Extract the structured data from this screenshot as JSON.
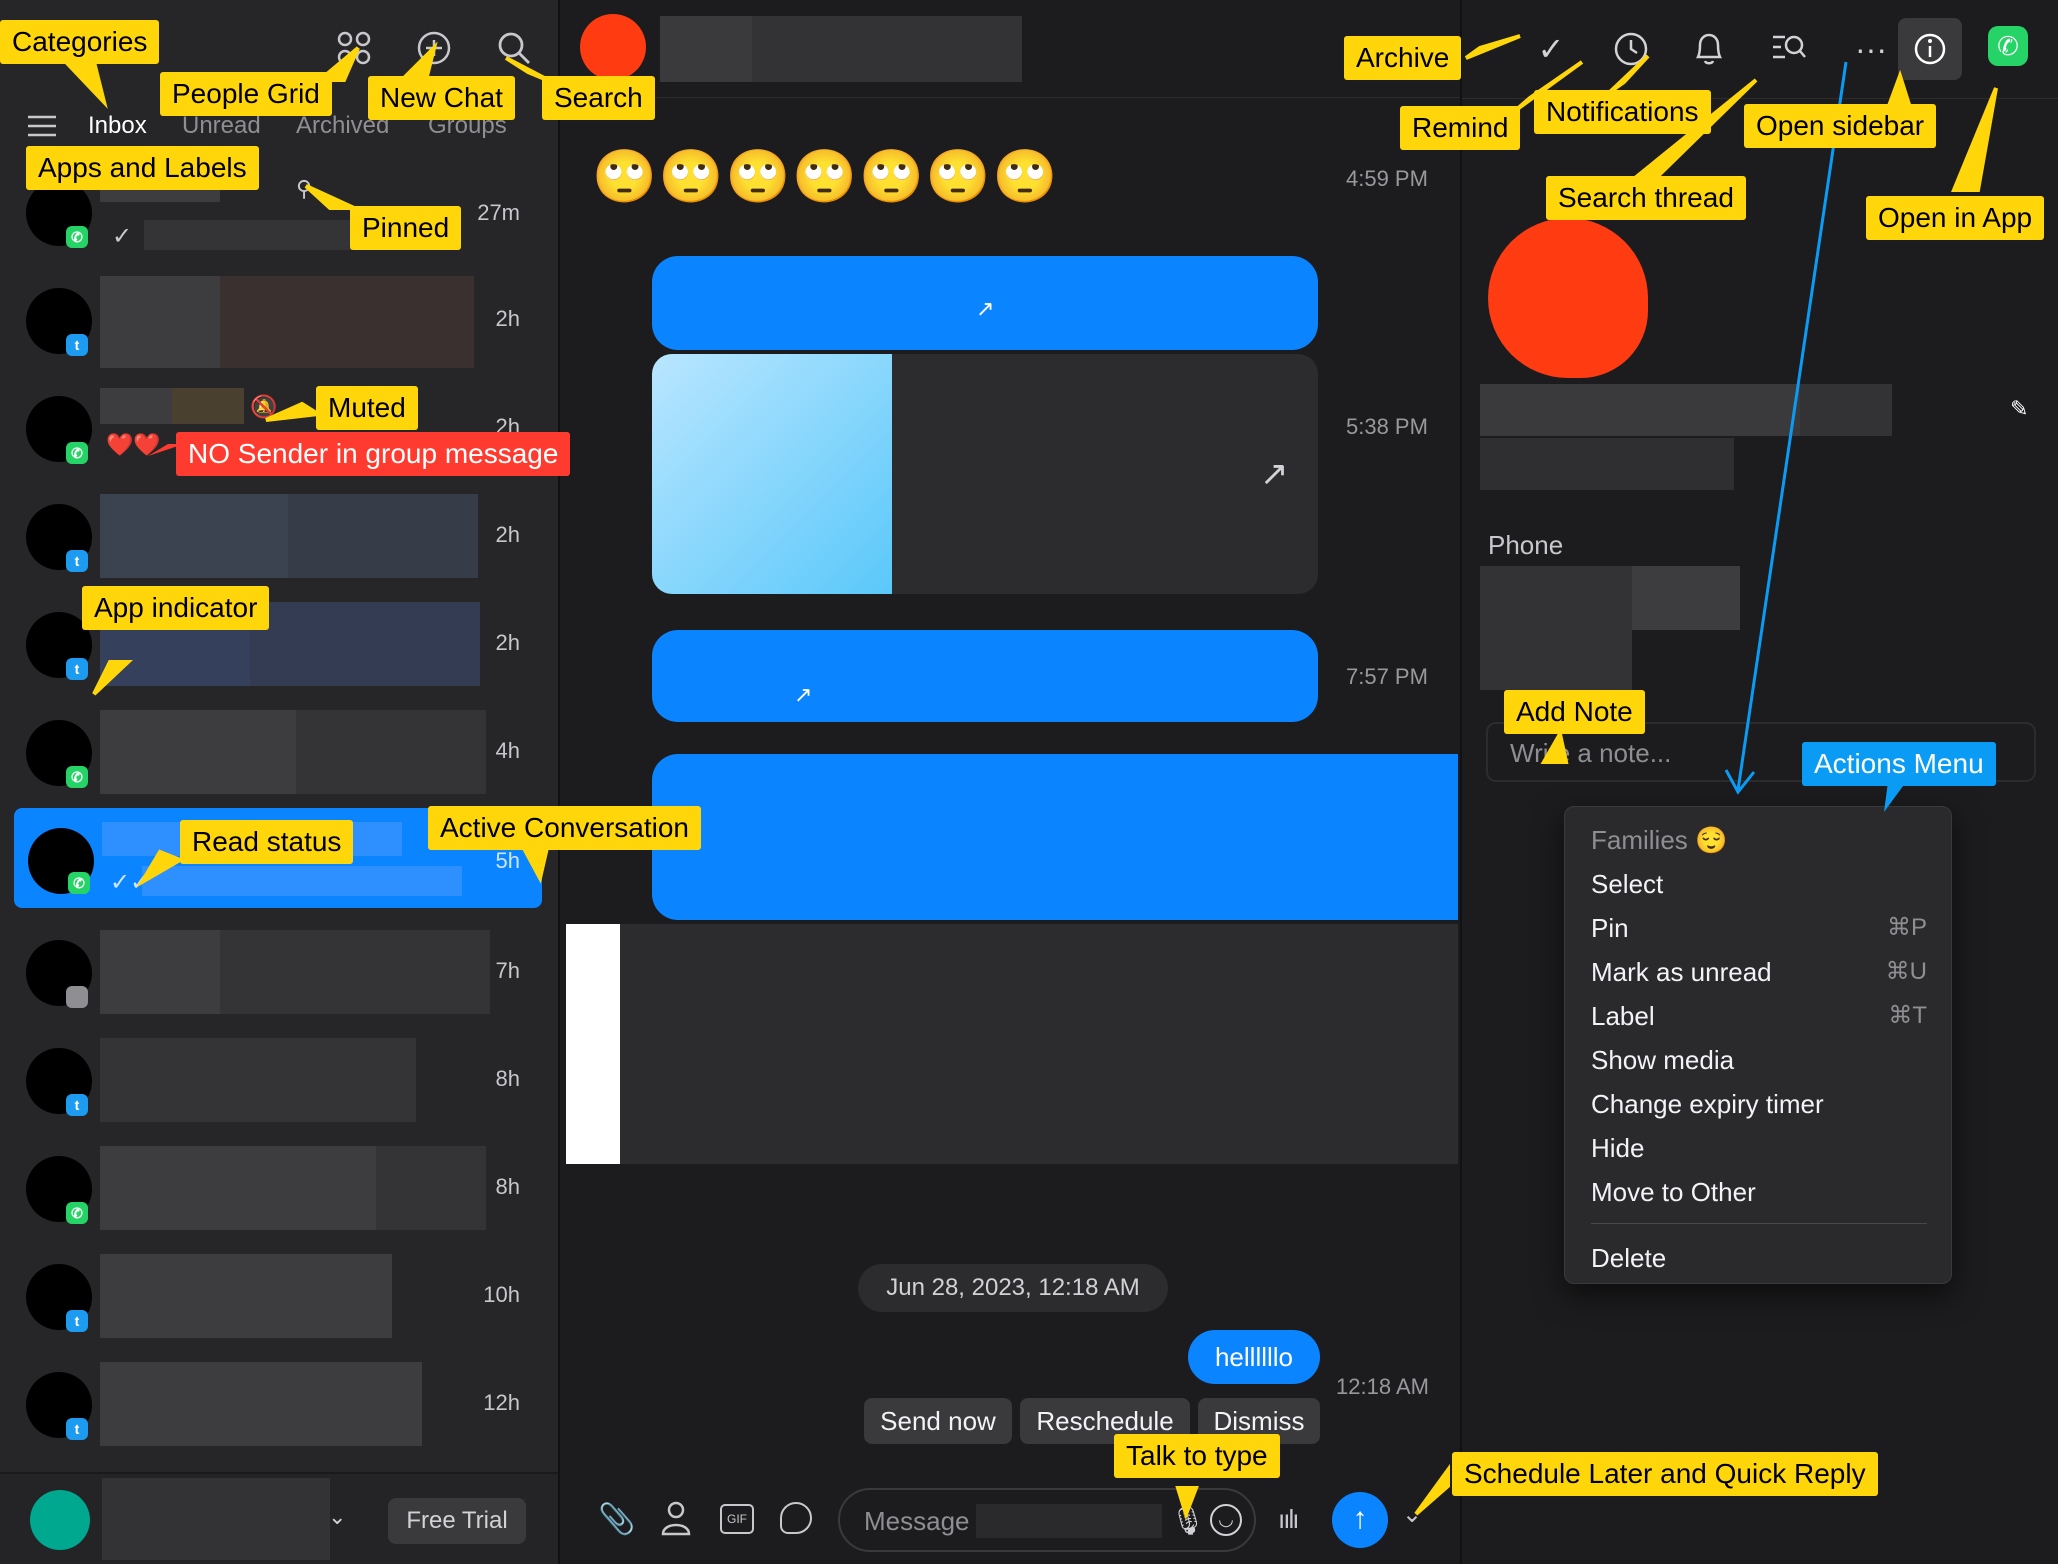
{
  "tabs": [
    "Inbox",
    "Unread",
    "Archived",
    "Groups"
  ],
  "conversations": [
    {
      "time": "27m",
      "app": "whatsapp"
    },
    {
      "time": "2h",
      "app": "twitter"
    },
    {
      "time": "2h",
      "app": "whatsapp",
      "preview_emoji": "❤️❤️"
    },
    {
      "time": "2h",
      "app": "twitter"
    },
    {
      "time": "2h",
      "app": "twitter"
    },
    {
      "time": "4h",
      "app": "whatsapp"
    },
    {
      "time": "5h",
      "app": "whatsapp"
    },
    {
      "time": "7h",
      "app": "apple"
    },
    {
      "time": "8h",
      "app": "twitter"
    },
    {
      "time": "8h",
      "app": "whatsapp"
    },
    {
      "time": "10h",
      "app": "twitter"
    },
    {
      "time": "12h",
      "app": "twitter"
    }
  ],
  "sidebar_footer": {
    "free_trial": "Free Trial"
  },
  "chat": {
    "emoji_row": "🙄🙄🙄🙄🙄🙄🙄",
    "times": [
      "4:59 PM",
      "5:38 PM",
      "7:57 PM",
      "12:18 AM"
    ],
    "date_divider": "Jun 28, 2023, 12:18 AM",
    "scheduled_message": "hellllllo",
    "actions": {
      "send_now": "Send now",
      "reschedule": "Reschedule",
      "dismiss": "Dismiss"
    },
    "composer_placeholder": "Message"
  },
  "right_pane": {
    "phone_label": "Phone",
    "note_placeholder": "Write a note...",
    "menu": {
      "header": "Families 😌",
      "items": [
        {
          "label": "Select",
          "shortcut": ""
        },
        {
          "label": "Pin",
          "shortcut": "⌘P"
        },
        {
          "label": "Mark as unread",
          "shortcut": "⌘U"
        },
        {
          "label": "Label",
          "shortcut": "⌘T"
        },
        {
          "label": "Show media",
          "shortcut": ""
        },
        {
          "label": "Change expiry timer",
          "shortcut": ""
        },
        {
          "label": "Hide",
          "shortcut": ""
        },
        {
          "label": "Move to Other",
          "shortcut": ""
        }
      ],
      "delete": "Delete"
    }
  },
  "annotations": {
    "categories": "Categories",
    "people_grid": "People Grid",
    "new_chat": "New Chat",
    "search": "Search",
    "apps_labels": "Apps and Labels",
    "pinned": "Pinned",
    "muted": "Muted",
    "no_sender": "NO Sender in group message",
    "app_indicator": "App indicator",
    "read_status": "Read status",
    "active_conversation": "Active Conversation",
    "archive": "Archive",
    "remind": "Remind",
    "notifications": "Notifications",
    "open_sidebar": "Open sidebar",
    "search_thread": "Search thread",
    "open_in_app": "Open in App",
    "add_note": "Add Note",
    "actions_menu": "Actions Menu",
    "talk_to_type": "Talk to type",
    "schedule_later": "Schedule Later and Quick Reply"
  },
  "colors": {
    "accent": "#0a84ff",
    "annotation": "#ffd60a",
    "annotation_red": "#ff3b30",
    "annotation_blue": "#0a9cf5"
  }
}
